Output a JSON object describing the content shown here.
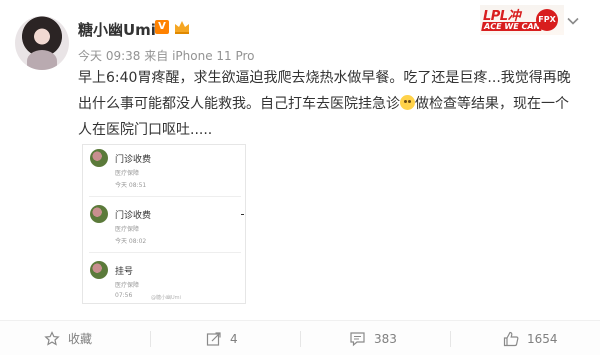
{
  "header": {
    "username": "糖小幽Umi",
    "vip_badge": "V",
    "time": "今天 09:38",
    "source_prefix": "来自",
    "source": "iPhone 11 Pro",
    "brand_top": "LPL冲",
    "brand_bottom": "ACE WE CAN",
    "brand_logo": "FPX"
  },
  "post": {
    "text_part1": "早上6:40胃疼醒，求生欲逼迫我爬去烧热水做早餐。吃了还是巨疼...我觉得再晚出什么事可能都没人能救我。自己打车去医院挂急诊",
    "text_part2": "做检查等结果，现在一个人在医院门口呕吐.....",
    "emoji_icon": "sad-face-emoji"
  },
  "attachment": {
    "records": [
      {
        "title": "门诊收费",
        "sub": "医疗保障",
        "time": "今天 08:51"
      },
      {
        "title": "门诊收费",
        "sub": "医疗保障",
        "time": "今天 08:02"
      },
      {
        "title": "挂号",
        "sub": "医疗保障",
        "time": "07:56"
      }
    ],
    "watermark": "@糖小幽Umi"
  },
  "footer": {
    "favorite_label": "收藏",
    "repost_count": "4",
    "comment_count": "383",
    "like_count": "1654"
  },
  "colors": {
    "text": "#333333",
    "meta": "#939393",
    "vip": "#ff8200",
    "brand": "#d81e1e"
  }
}
